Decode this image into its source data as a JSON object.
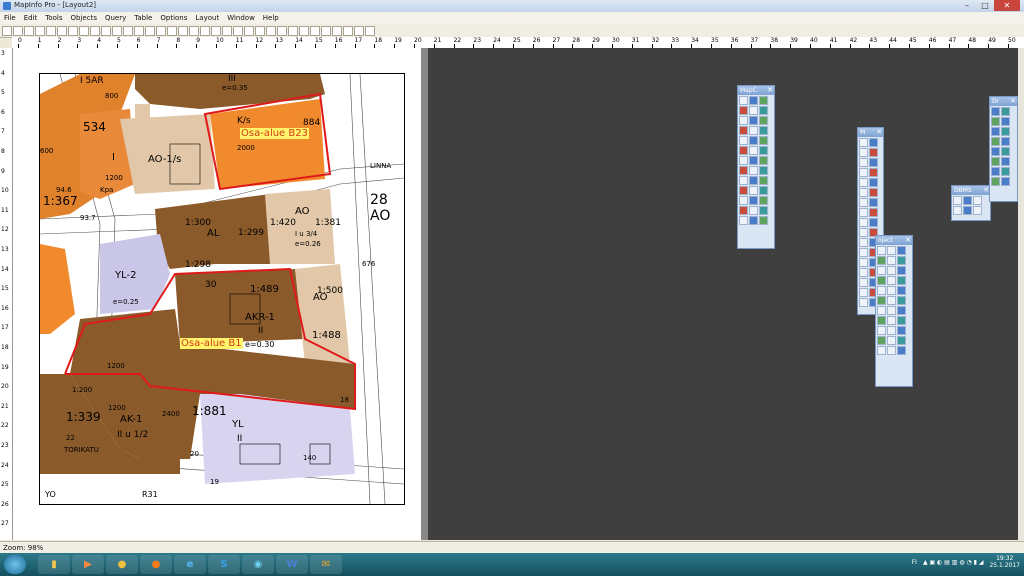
{
  "window": {
    "title": "MapInfo Pro - [Layout2]",
    "min": "–",
    "max": "□",
    "close": "✕"
  },
  "menu": [
    "File",
    "Edit",
    "Tools",
    "Objects",
    "Query",
    "Table",
    "Options",
    "Layout",
    "Window",
    "Help"
  ],
  "ruler_h": [
    "0",
    "1",
    "2",
    "3",
    "4",
    "5",
    "6",
    "7",
    "8",
    "9",
    "10",
    "11",
    "12",
    "13",
    "14",
    "15",
    "16",
    "17",
    "18",
    "19",
    "20",
    "21",
    "22",
    "23",
    "24",
    "25",
    "26",
    "27",
    "28",
    "29",
    "30",
    "31",
    "32",
    "33",
    "34",
    "35",
    "36",
    "37",
    "38",
    "39",
    "40",
    "41",
    "42",
    "43",
    "44",
    "45",
    "46",
    "47",
    "48",
    "49",
    "50"
  ],
  "ruler_v": [
    "3",
    "4",
    "5",
    "6",
    "7",
    "8",
    "9",
    "10",
    "11",
    "12",
    "13",
    "14",
    "15",
    "16",
    "17",
    "18",
    "19",
    "20",
    "21",
    "22",
    "23",
    "24",
    "25",
    "26",
    "27"
  ],
  "palettes": {
    "mapc": "MapC",
    "m": "M",
    "object": "oject",
    "dbms": "DBMS",
    "dr": "Dr",
    "close": "✕"
  },
  "map": {
    "labels": {
      "l_1sar": "I 5AR",
      "l_800": "800",
      "l_534": "534",
      "l_600": "600",
      "l_aoi1s": "AO-1/s",
      "l_i": "I",
      "l_kpa": "Kpa",
      "l_1200a": "1200",
      "l_367": "1:367",
      "l_946": "94.6",
      "l_937": "93.7",
      "l_kg": "K/s",
      "l_884": "884",
      "l_2000": "2000",
      "l_iii": "III",
      "l_e035": "e=0.35",
      "l_linna": "LINNA",
      "l_28": "28",
      "l_ao": "AO",
      "l_al": "AL",
      "l_300": "1:300",
      "l_299": "1:299",
      "l_298": "1:298",
      "l_420": "1:420",
      "l_381": "1:381",
      "l_ao2": "AO",
      "l_i34": "I u 3/4",
      "l_e026": "e=0.26",
      "l_676": "676",
      "l_yl2": "YL-2",
      "l_30": "30",
      "l_489": "1:489",
      "l_akr1": "AKR-1",
      "l_ii": "II",
      "l_e030": "e=0.30",
      "l_500": "1:500",
      "l_ao3": "AO",
      "l_488": "1:488",
      "l_e25": "e=0.25",
      "l_1200b": "1200",
      "l_1200c": "1:200",
      "l_339": "1:339",
      "l_1200d": "1200",
      "l_ak1": "AK-1",
      "l_iiu": "II u 1/2",
      "l_2400": "2400",
      "l_881": "1:881",
      "l_yl": "YL",
      "l_iib": "II",
      "l_22": "22",
      "l_20": "20",
      "l_19": "19",
      "l_18": "18",
      "l_torikatu": "TORIKATU",
      "l_140": "140",
      "l_r31": "R31",
      "l_yo": "YO"
    },
    "callouts": {
      "b23": "Osa-alue B23",
      "b1": "Osa-alue B1"
    }
  },
  "status": {
    "zoom": "Zoom: 98%"
  },
  "taskbar": {
    "items": [
      "e",
      "S",
      "W"
    ],
    "lang": "FI",
    "time": "19:32",
    "date": "25.1.2017"
  },
  "colors": {
    "dark_brown": "#8b5a2b",
    "orange": "#f08a2d",
    "tan": "#e2c8a8",
    "lavender": "#c9c6e8",
    "boundary_red": "#e01a1a",
    "workspace": "#3f3f3f",
    "callout_bg": "#fff46a",
    "callout_text": "#d23b1b"
  }
}
